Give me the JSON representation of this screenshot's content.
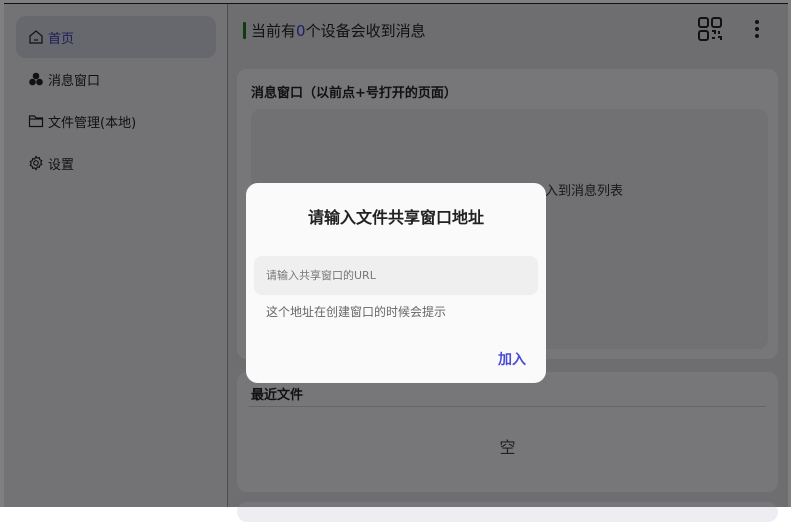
{
  "sidebar": {
    "items": [
      {
        "label": "首页",
        "icon": "home-icon"
      },
      {
        "label": "消息窗口",
        "icon": "clover-icon"
      },
      {
        "label": "文件管理(本地)",
        "icon": "folder-icon"
      },
      {
        "label": "设置",
        "icon": "gear-icon"
      }
    ]
  },
  "header": {
    "status_prefix": "当前有",
    "device_count": "0",
    "status_suffix": "个设备会收到消息"
  },
  "cards": {
    "messages": {
      "title": "消息窗口（以前点+号打开的页面）",
      "hint_visible": "入到消息列表"
    },
    "recent": {
      "title": "最近文件",
      "empty": "空"
    }
  },
  "modal": {
    "title": "请输入文件共享窗口地址",
    "placeholder": "请输入共享窗口的URL",
    "value": "",
    "help": "这个地址在创建窗口的时候会提示",
    "join_label": "加入"
  },
  "colors": {
    "accent": "#4a4ad8",
    "status_bar": "#1a7a1a"
  }
}
